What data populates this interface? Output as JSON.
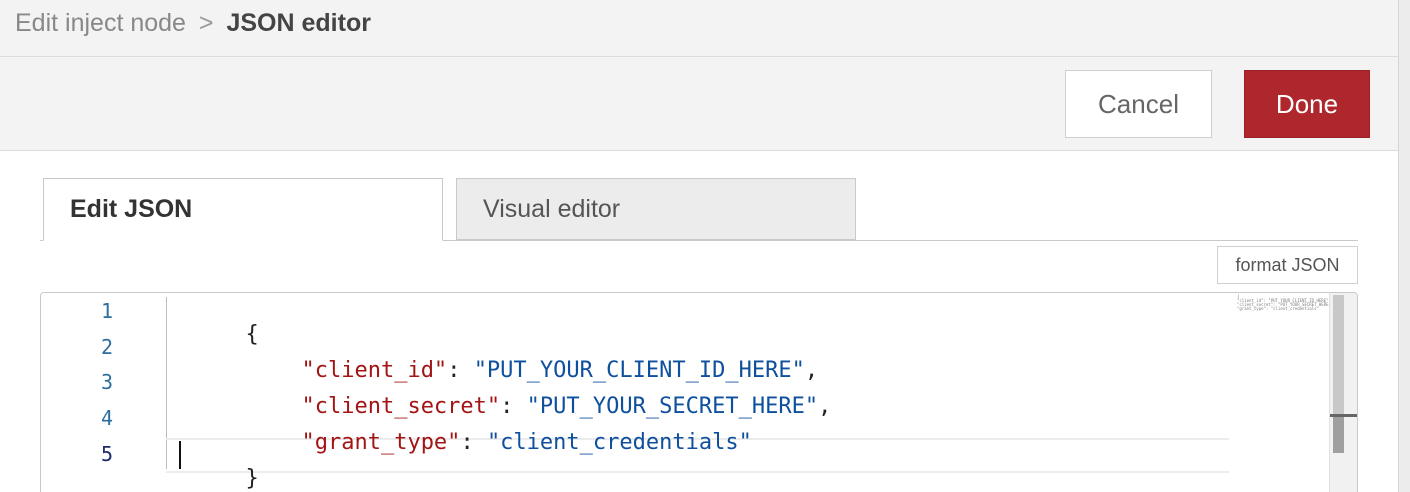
{
  "breadcrumb": {
    "parent": "Edit inject node",
    "separator": ">",
    "current": "JSON editor"
  },
  "toolbar": {
    "cancel_label": "Cancel",
    "done_label": "Done"
  },
  "tabs": [
    {
      "label": "Edit JSON",
      "active": true
    },
    {
      "label": "Visual editor",
      "active": false
    }
  ],
  "format_button": "format JSON",
  "editor": {
    "line_numbers": [
      "1",
      "2",
      "3",
      "4",
      "5"
    ],
    "current_line": "5",
    "lines": {
      "l1": "{",
      "l2_key": "\"client_id\"",
      "l2_sep": ": ",
      "l2_val": "\"PUT_YOUR_CLIENT_ID_HERE\"",
      "l2_end": ",",
      "l3_key": "\"client_secret\"",
      "l3_sep": ": ",
      "l3_val": "\"PUT_YOUR_SECRET_HERE\"",
      "l3_end": ",",
      "l4_key": "\"grant_type\"",
      "l4_sep": ": ",
      "l4_val": "\"client_credentials\"",
      "l5": "}"
    },
    "minimap": [
      "{",
      "  \"client_id\": \"PUT_YOUR_CLIENT_ID_HERE\",",
      "  \"client_secret\": \"PUT_YOUR_SECRET_HERE\",",
      "  \"grant_type\": \"client_credentials\""
    ]
  },
  "colors": {
    "done_button": "#ad272d",
    "json_key": "#a31515",
    "json_string": "#0e4f9e",
    "line_number": "#2c6e9e"
  }
}
